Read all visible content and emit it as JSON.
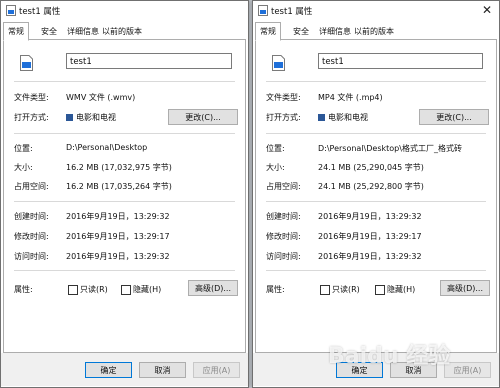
{
  "tabs": [
    "常规",
    "安全",
    "详细信息",
    "以前的版本"
  ],
  "labels": {
    "file_type": "文件类型:",
    "open_with": "打开方式:",
    "location": "位置:",
    "size": "大小:",
    "size_on_disk": "占用空间:",
    "created": "创建时间:",
    "modified": "修改时间:",
    "accessed": "访问时间:",
    "attributes": "属性:",
    "readonly": "只读(R)",
    "hidden": "隐藏(H)"
  },
  "buttons": {
    "change": "更改(C)...",
    "advanced": "高级(D)...",
    "ok": "确定",
    "cancel": "取消",
    "apply": "应用(A)"
  },
  "dialogs": [
    {
      "title": "test1 属性",
      "name": "test1",
      "file_type": "WMV 文件 (.wmv)",
      "open_with": "电影和电视",
      "location": "D:\\Personal\\Desktop",
      "size": "16.2 MB (17,032,975 字节)",
      "size_on_disk": "16.2 MB (17,035,264 字节)",
      "created": "2016年9月19日，13:29:32",
      "modified": "2016年9月19日，13:29:17",
      "accessed": "2016年9月19日，13:29:32"
    },
    {
      "title": "test1 属性",
      "name": "test1",
      "file_type": "MP4 文件 (.mp4)",
      "open_with": "电影和电视",
      "location": "D:\\Personal\\Desktop\\格式工厂_格式砖",
      "size": "24.1 MB (25,290,045 字节)",
      "size_on_disk": "24.1 MB (25,292,800 字节)",
      "created": "2016年9月19日，13:29:32",
      "modified": "2016年9月19日，13:29:17",
      "accessed": "2016年9月19日，13:29:32"
    }
  ],
  "watermark": "Baidu 经验"
}
